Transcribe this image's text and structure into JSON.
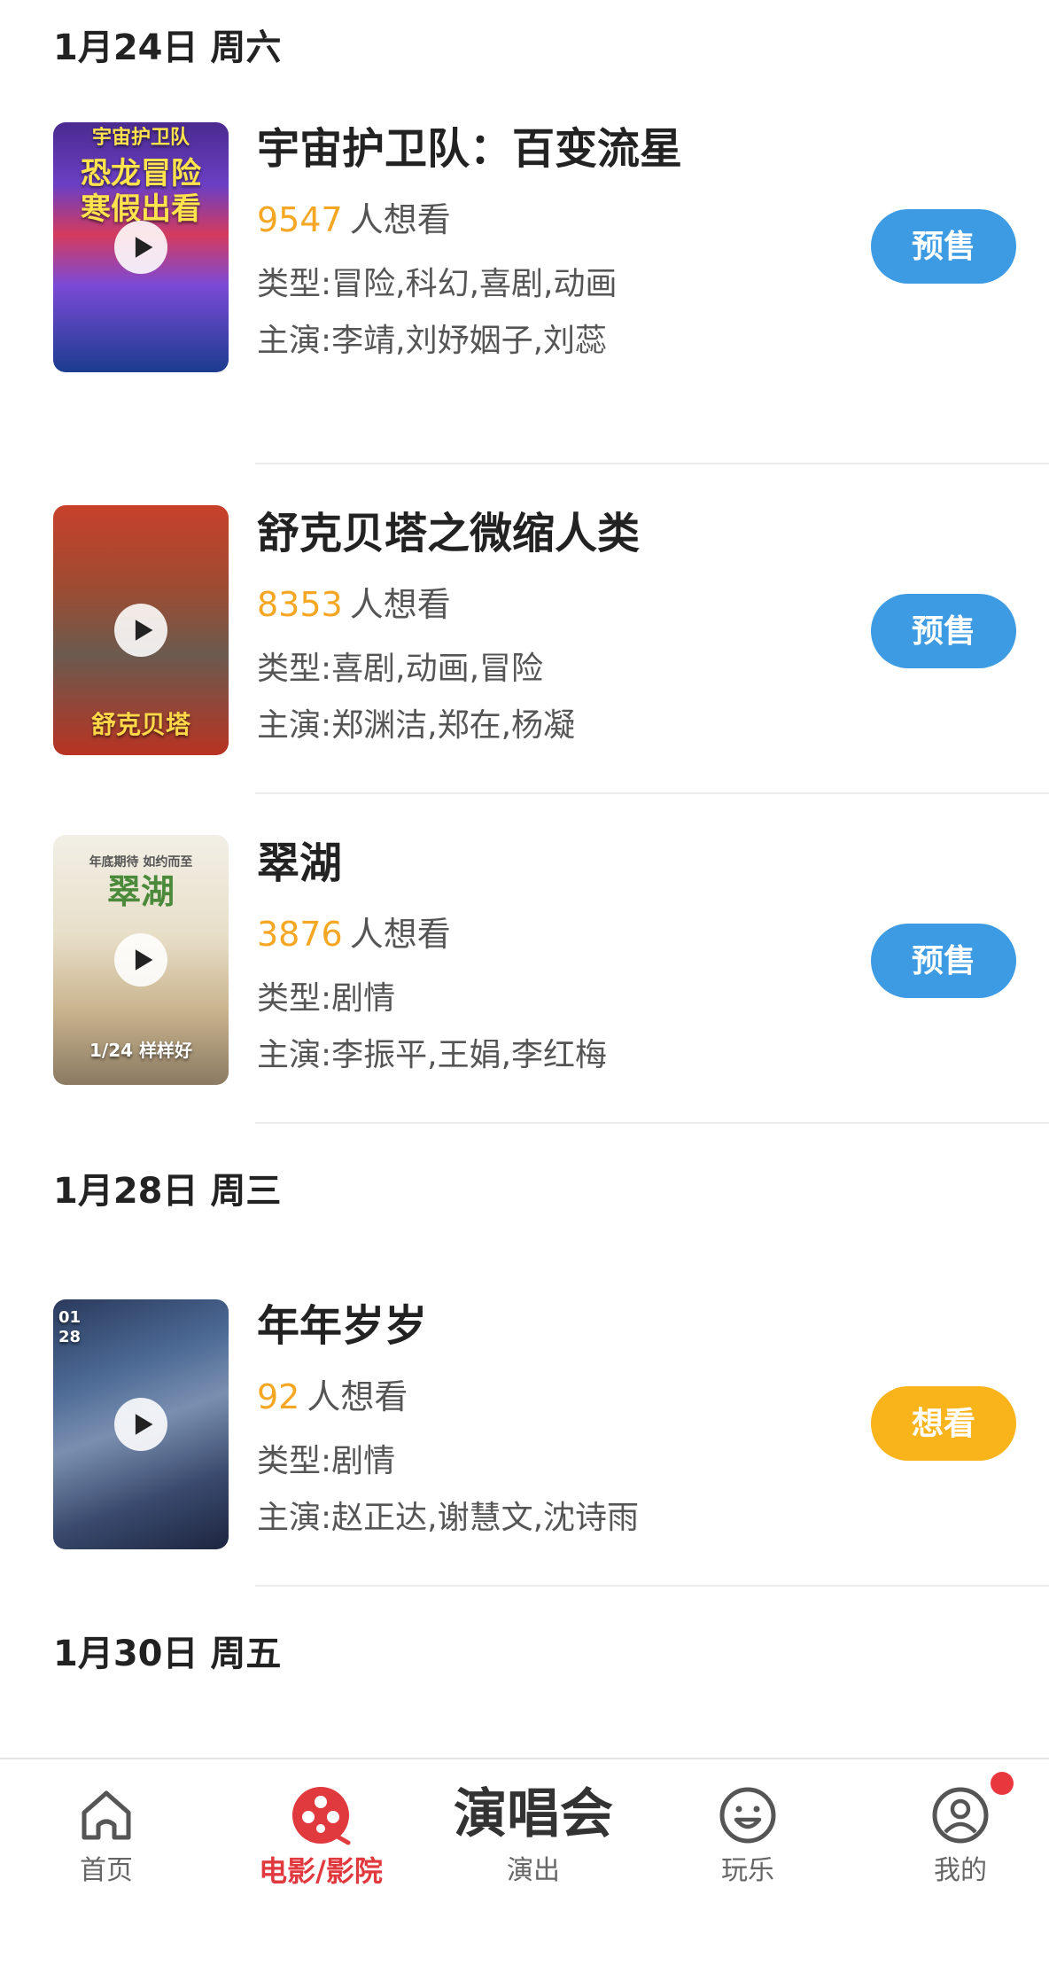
{
  "sections": [
    {
      "date_label": "1月24日 周六",
      "movies": [
        {
          "title": "宇宙护卫队：百变流星",
          "want_count": "9547",
          "want_label": "人想看",
          "genre": "类型:冒险,科幻,喜剧,动画",
          "cast": "主演:李靖,刘妤姻子,刘蕊",
          "action": "预售",
          "poster_top": "宇宙护卫队",
          "poster_main": "恐龙冒险\n寒假出看"
        },
        {
          "title": "舒克贝塔之微缩人类",
          "want_count": "8353",
          "want_label": "人想看",
          "genre": "类型:喜剧,动画,冒险",
          "cast": "主演:郑渊洁,郑在,杨凝",
          "action": "预售",
          "poster_bottom": "舒克贝塔"
        },
        {
          "title": "翠湖",
          "want_count": "3876",
          "want_label": "人想看",
          "genre": "类型:剧情",
          "cast": "主演:李振平,王娟,李红梅",
          "action": "预售",
          "poster_top": "年底期待 如约而至",
          "poster_main": "翠湖",
          "poster_bottom": "1/24 样样好"
        }
      ]
    },
    {
      "date_label": "1月28日 周三",
      "movies": [
        {
          "title": "年年岁岁",
          "want_count": "92",
          "want_label": "人想看",
          "genre": "类型:剧情",
          "cast": "主演:赵正达,谢慧文,沈诗雨",
          "action": "想看",
          "poster_date": "01\n28"
        }
      ]
    },
    {
      "date_label": "1月30日 周五",
      "movies": []
    }
  ],
  "tab_bar": {
    "home": "首页",
    "movies": "电影/影院",
    "concert_big": "演唱会",
    "concert": "演出",
    "fun": "玩乐",
    "mine": "我的"
  },
  "colors": {
    "presale_button": "#3d9be3",
    "want_button": "#f9b31b",
    "want_count": "#f5a623",
    "active_tab": "#e0393e",
    "badge": "#e8383d"
  },
  "icons": {
    "home": "home-icon",
    "movies": "film-reel-icon",
    "fun": "smiley-icon",
    "mine": "user-icon",
    "play": "play-icon"
  }
}
